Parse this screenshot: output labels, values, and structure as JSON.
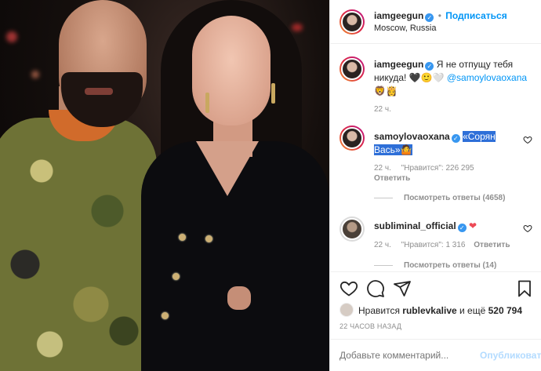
{
  "header": {
    "username": "iamgeegun",
    "separator": "•",
    "follow_label": "Подписаться",
    "location": "Moscow, Russia"
  },
  "caption": {
    "username": "iamgeegun",
    "text_part1": "Я не отпущу тебя",
    "text_part2": "никуда!",
    "emoji_hearts": "🖤🙂🤍",
    "mention": "@samoylovaoxana",
    "emoji_faces": "🦁👸",
    "time": "22 ч."
  },
  "comments": [
    {
      "username": "samoylovaoxana",
      "text_line1": "«Сорян",
      "text_line2": "Вась»",
      "emoji": "🤷",
      "time": "22 ч.",
      "likes": "\"Нравится\": 226 295",
      "reply_label": "Ответить",
      "view_replies": "Посмотреть ответы (4658)"
    },
    {
      "username": "subliminal_official",
      "emoji": "❤",
      "time": "22 ч.",
      "likes": "\"Нравится\": 1 316",
      "reply_label": "Ответить",
      "view_replies": "Посмотреть ответы (14)"
    }
  ],
  "likes_section": {
    "prefix": "Нравится",
    "liker": "rublevkalive",
    "middle": "и ещё",
    "count": "520 794",
    "timestamp": "22 ЧАСОВ НАЗАД"
  },
  "comment_box": {
    "placeholder": "Добавьте комментарий...",
    "publish_label": "Опубликовать"
  },
  "colors": {
    "accent": "#0095f6",
    "verified": "#3897f0",
    "like_red": "#ed4956"
  },
  "icons": [
    "heart-icon",
    "comment-icon",
    "share-icon",
    "bookmark-icon",
    "more-icon",
    "verified-icon"
  ]
}
